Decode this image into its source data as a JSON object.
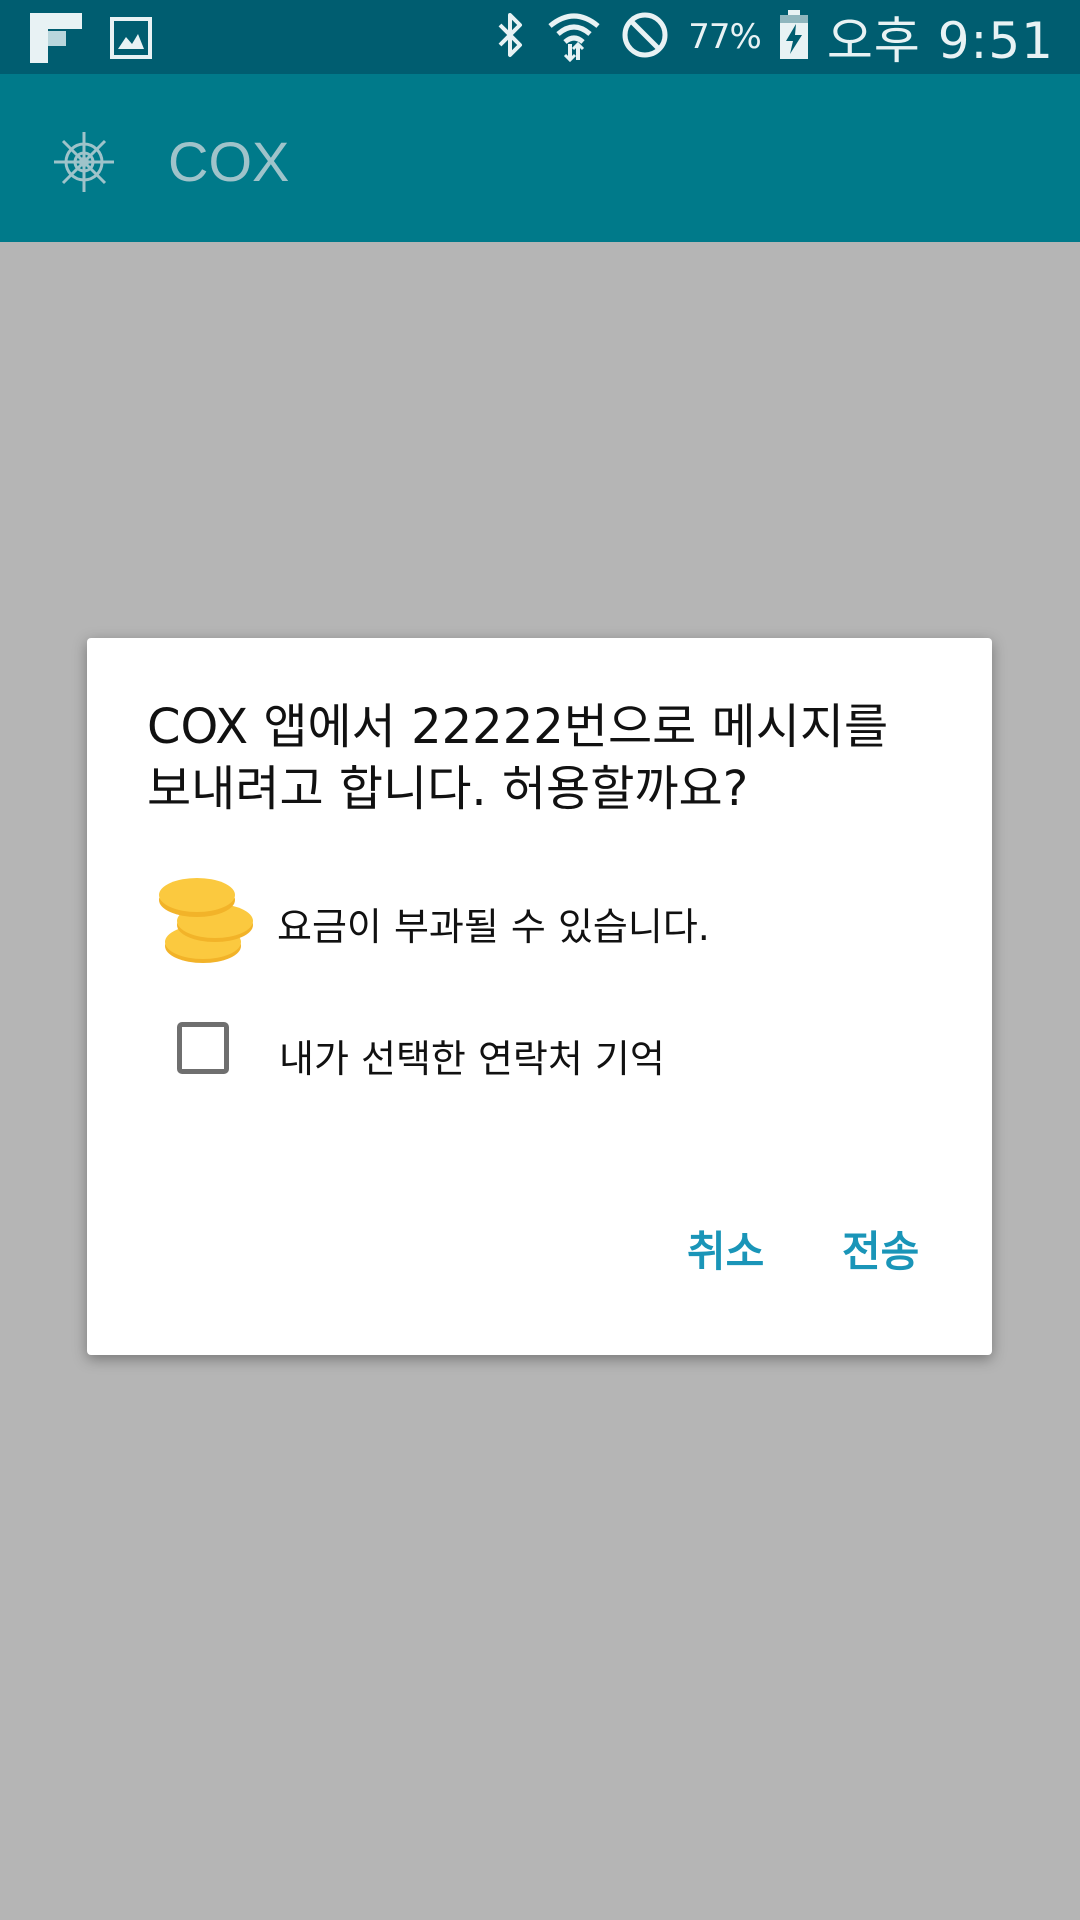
{
  "status_bar": {
    "battery_percent": "77%",
    "time": "오후 9:51",
    "icons": [
      "flipboard-icon",
      "image-icon",
      "bluetooth-icon",
      "wifi-icon",
      "block-icon",
      "battery-charging-icon"
    ]
  },
  "app_bar": {
    "title": "COX",
    "color": "#007a8a"
  },
  "dialog": {
    "title": "COX 앱에서 22222번으로 메시지를 보내려고 합니다. 허용할까요?",
    "fee_notice": "요금이 부과될 수 있습니다.",
    "remember_label": "내가 선택한 연락처 기억",
    "remember_checked": false,
    "cancel_label": "취소",
    "send_label": "전송",
    "button_color": "#1a95b8"
  }
}
